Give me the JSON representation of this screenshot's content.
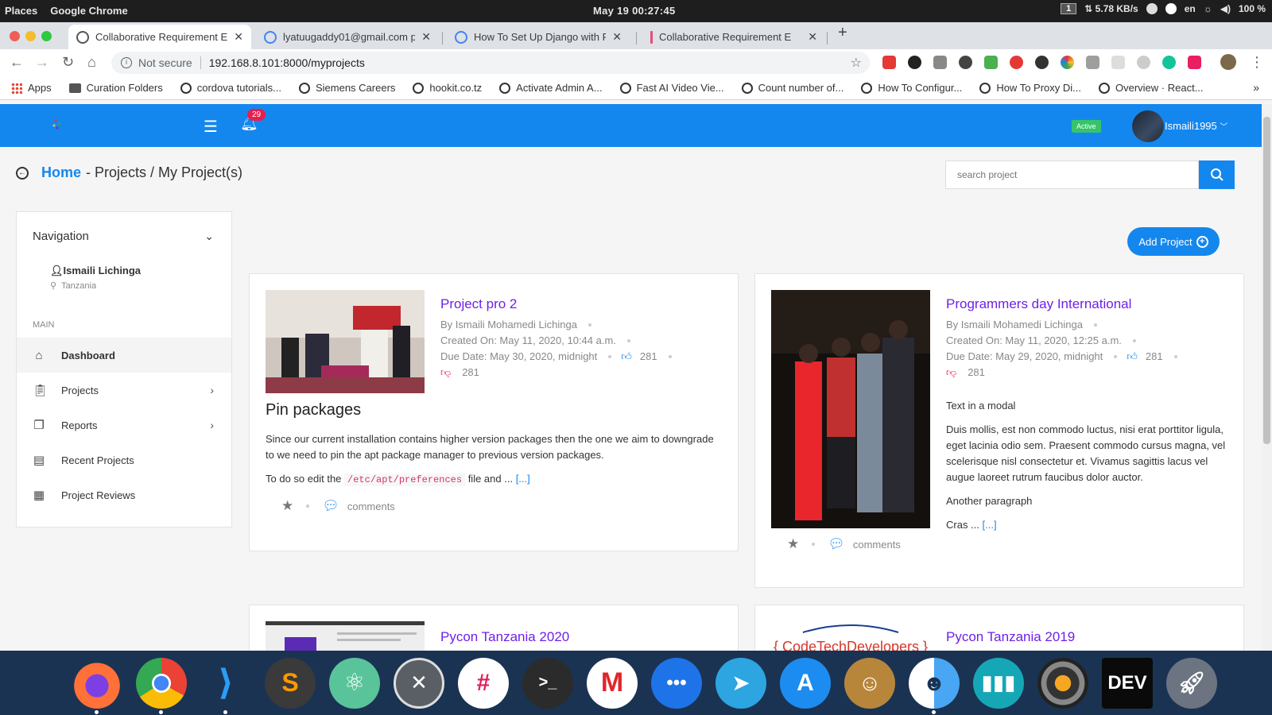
{
  "system_bar": {
    "places": "Places",
    "app": "Google Chrome",
    "clock": "May 19  00:27:45",
    "workspace": "1",
    "net_speed": "⇅ 5.78 KB/s",
    "lang": "en",
    "battery": "100 %"
  },
  "tabs": [
    {
      "title": "Collaborative Requirement E",
      "active": true
    },
    {
      "title": "lyatuugaddy01@gmail.com p",
      "active": false
    },
    {
      "title": "How To Set Up Django with P",
      "active": false
    },
    {
      "title": "Collaborative Requirement E",
      "active": false
    }
  ],
  "address_bar": {
    "security": "Not secure",
    "url": "192.168.8.101:8000/myprojects"
  },
  "bookmarks": [
    "Apps",
    "Curation Folders",
    "cordova tutorials...",
    "Siemens Careers",
    "hookit.co.tz",
    "Activate Admin A...",
    "Fast AI Video Vie...",
    "Count number of...",
    "How To Configur...",
    "How To Proxy Di...",
    "Overview · React..."
  ],
  "header": {
    "notification_count": "29",
    "status": "Active",
    "username": "Ismaili1995"
  },
  "breadcrumb": {
    "home": "Home",
    "rest": "- Projects / My Project(s)"
  },
  "search": {
    "placeholder": "search project"
  },
  "sidebar": {
    "title": "Navigation",
    "user_name": "Ismaili Lichinga",
    "user_location": "Tanzania",
    "section": "MAIN",
    "items": [
      {
        "label": "Dashboard"
      },
      {
        "label": "Projects"
      },
      {
        "label": "Reports"
      },
      {
        "label": "Recent Projects"
      },
      {
        "label": "Project Reviews"
      }
    ]
  },
  "add_project_label": "Add Project",
  "projects": [
    {
      "title": "Project pro 2",
      "author": "By Ismaili Mohamedi Lichinga",
      "created": "Created On: May 11, 2020, 10:44 a.m.",
      "due": "Due Date: May 30, 2020, midnight",
      "likes": "281",
      "dislikes": "281",
      "heading": "Pin packages",
      "para1": "Since our current installation contains higher version packages then the one we aim to downgrade to we need to pin the apt package manager to previous version packages.",
      "para2_pre": "To do so edit the",
      "para2_code": "/etc/apt/preferences",
      "para2_post": "file and ...",
      "more": "[...]",
      "comments": "comments"
    },
    {
      "title": "Programmers day International",
      "author": "By Ismaili Mohamedi Lichinga",
      "created": "Created On: May 11, 2020, 12:25 a.m.",
      "due": "Due Date: May 29, 2020, midnight",
      "likes": "281",
      "dislikes": "281",
      "para1": "Text in a modal",
      "para2": "Duis mollis, est non commodo luctus, nisi erat porttitor ligula, eget lacinia odio sem. Praesent commodo cursus magna, vel scelerisque nisl consectetur et. Vivamus sagittis lacus vel augue laoreet rutrum faucibus dolor auctor.",
      "para3": "Another paragraph",
      "para4": "Cras ...",
      "more": "[...]",
      "comments": "comments"
    },
    {
      "title": "Pycon Tanzania 2020"
    },
    {
      "title": "Pycon Tanzania 2019",
      "logo_text": "{ CodeTechDevelopers }"
    }
  ],
  "dock": [
    "Firefox",
    "Chrome",
    "VS Code",
    "Sublime Text",
    "Atom",
    "Xmind",
    "Slack",
    "Terminal",
    "Mailspring",
    "Messages",
    "Telegram",
    "App Store",
    "Contacts",
    "Finder",
    "Statistics",
    "Audio",
    "DEV",
    "Launcher"
  ]
}
